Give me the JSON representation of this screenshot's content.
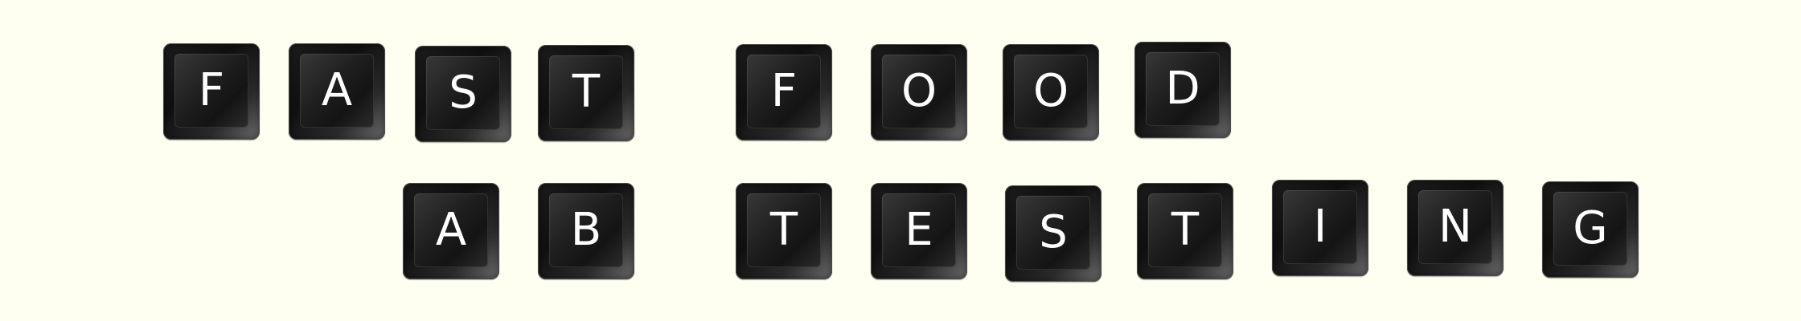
{
  "words": {
    "fast": [
      "F",
      "A",
      "S",
      "T"
    ],
    "food": [
      "F",
      "O",
      "O",
      "D"
    ],
    "ab": [
      "A",
      "B"
    ],
    "testing": [
      "T",
      "E",
      "S",
      "T",
      "I",
      "N",
      "G"
    ]
  }
}
